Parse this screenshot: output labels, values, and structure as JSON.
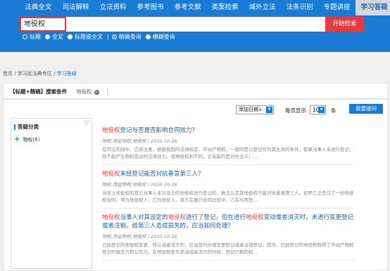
{
  "nav": {
    "items": [
      "法典全文",
      "司法解释",
      "立法资料",
      "参考图书",
      "参考文献",
      "类案检索",
      "域外立法",
      "法条识别",
      "专题讲座",
      "学习答疑"
    ],
    "active_index": 9
  },
  "search": {
    "query": "地役权",
    "button_label": "开始检索",
    "options": [
      "标题",
      "全文",
      "标题或全文",
      "精确查询",
      "模糊查询"
    ]
  },
  "breadcrumb": {
    "home": "首页",
    "sep": " / ",
    "section": "学习民法典专区",
    "current": "学习答疑"
  },
  "filter": {
    "label": "【标题+精确】搜索条件",
    "tag": "地役权",
    "close": "×",
    "pipe": "|"
  },
  "toolbar": {
    "sort_value": "添加日期↓",
    "per_page_label": "每页显示",
    "page_size": "10",
    "unit": "条",
    "ask_button": "我要提问"
  },
  "sidebar": {
    "header": "答疑分类",
    "toggle": "▽",
    "item_plus": "+",
    "item_label": "物权(6)"
  },
  "results": [
    {
      "title_parts": [
        {
          "text": "地役权",
          "hl": true
        },
        {
          "text": "登记与否是否影响合同效力？",
          "hl": false
        }
      ],
      "meta": "物权,用益物权,地役权 / 2020-10-26",
      "snippet": "在司法实践中，应该注意，根据我国的法律规定，不动产物权，一般的是以登记作为其生效的条件，如果当事人未进行登记，则不能产生物权变动的法律效力。但地役权则不同，它采取的是对抗主义；..."
    },
    {
      "title_parts": [
        {
          "text": "地役权",
          "hl": true
        },
        {
          "text": "未经登记能否对抗善意第三人？",
          "hl": false
        }
      ],
      "meta": "物权,用益物权,地役权 / 2020-10-26",
      "snippet": "当设立地役权的双方当事人未对设立的地役权进行登记的，依法认定其地役权不能对抗善意第三人。如甲乙之签订了一份地役权合同，甲为地役权人，乙为地役人。双方在履行合同过程中，乙在与丙签..."
    },
    {
      "title_parts": [
        {
          "text": "地役权",
          "hl": true
        },
        {
          "text": "当事人对其设定的",
          "hl": false
        },
        {
          "text": "地役权",
          "hl": true
        },
        {
          "text": "进行了登记，但在进行",
          "hl": false
        },
        {
          "text": "地役权",
          "hl": true
        },
        {
          "text": "变动或者消灭时，未进行变更登记或者注销，给第三人造成损失的，应当如何处理？",
          "hl": false
        }
      ],
      "meta": "物权,用益物权,地役权 / 2020-10-26",
      "snippet": "已经登记的地役权变更、转让或者消灭的，应当及时办理变更登记或者注销登记。因为，已经登记的地役权取得了不动产物权登记的推定力和公信力。在地役权发生变动或者消灭的时候，登记已数的权..."
    }
  ]
}
